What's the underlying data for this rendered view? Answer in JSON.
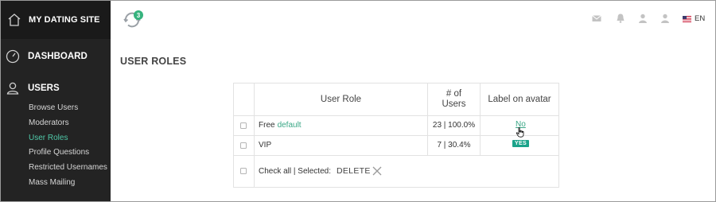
{
  "brand": {
    "title": "MY DATING SITE"
  },
  "nav": {
    "dashboard": "DASHBOARD",
    "users": "USERS",
    "sub_items": [
      "Browse Users",
      "Moderators",
      "User Roles",
      "Profile Questions",
      "Restricted Usernames",
      "Mass Mailing"
    ],
    "active_sub": "User Roles"
  },
  "topbar": {
    "sync_badge": "3",
    "language": "EN"
  },
  "page": {
    "title": "USER ROLES"
  },
  "table": {
    "headers": {
      "role": "User Role",
      "users_line1": "# of",
      "users_line2": "Users",
      "label": "Label on avatar"
    },
    "rows": [
      {
        "role": "Free",
        "tag": "default",
        "users": "23 | 100.0%",
        "label": "No"
      },
      {
        "role": "VIP",
        "tag": "",
        "users": "7 | 30.4%",
        "label": "YES"
      }
    ],
    "footer": {
      "check_all": "Check all | Selected:",
      "delete": "DELETE"
    }
  },
  "colors": {
    "sidebar": "#232323",
    "brand_bg": "#1a1a1a",
    "accent": "#4fc8a8",
    "yes_badge": "#1ba38a"
  }
}
